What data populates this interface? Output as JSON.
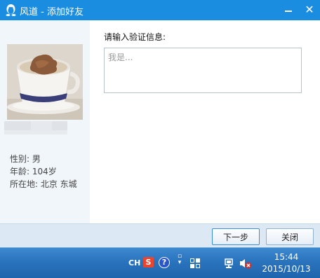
{
  "window": {
    "app_name": "风道",
    "separator": " - ",
    "title": "添加好友",
    "minimize_label": "",
    "close_label": "✕"
  },
  "profile": {
    "gender": "性别: 男",
    "age": "年龄: 104岁",
    "location": "所在地: 北京  东城"
  },
  "verification": {
    "label": "请输入验证信息:",
    "placeholder": "我是..."
  },
  "buttons": {
    "next": "下一步",
    "close": "关闭"
  },
  "taskbar": {
    "lang": "CH",
    "sogou": "S",
    "help": "?",
    "time": "15:44",
    "date": "2015/10/13"
  }
}
